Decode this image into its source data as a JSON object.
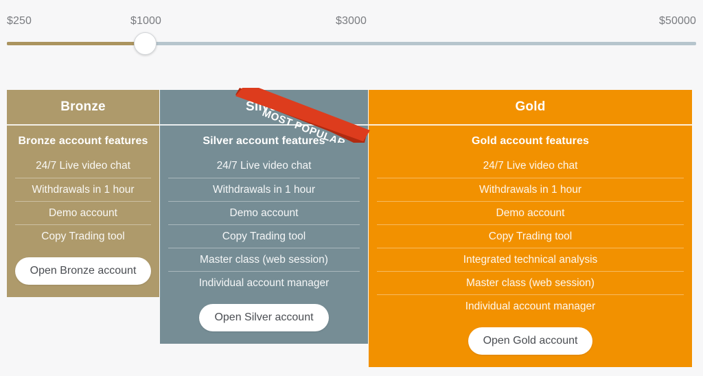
{
  "slider": {
    "ticks": [
      {
        "label": "$250"
      },
      {
        "label": "$1000"
      },
      {
        "label": "$3000"
      },
      {
        "label": "$50000"
      }
    ],
    "selected_value": "$1000",
    "fill_color": "#ab945f",
    "track_color": "#b6c5cd",
    "thumb_color": "#ffffff",
    "fill_percent": 20
  },
  "ribbon": {
    "label": "MOST POPULAR",
    "color": "#dd3c1d"
  },
  "plans": [
    {
      "id": "bronze",
      "name": "Bronze",
      "color": "#ae9a6b",
      "features_title": "Bronze account features",
      "features": [
        "24/7 Live video chat",
        "Withdrawals in 1 hour",
        "Demo account",
        "Copy Trading tool"
      ],
      "button_label": "Open Bronze account"
    },
    {
      "id": "silver",
      "name": "Silver",
      "color": "#768d95",
      "features_title": "Silver account features",
      "features": [
        "24/7 Live video chat",
        "Withdrawals in 1 hour",
        "Demo account",
        "Copy Trading tool",
        "Master class (web session)",
        "Individual account manager"
      ],
      "button_label": "Open Silver account",
      "most_popular": true
    },
    {
      "id": "gold",
      "name": "Gold",
      "color": "#f29100",
      "features_title": "Gold account features",
      "features": [
        "24/7 Live video chat",
        "Withdrawals in 1 hour",
        "Demo account",
        "Copy Trading tool",
        "Integrated technical analysis",
        "Master class (web session)",
        "Individual account manager"
      ],
      "button_label": "Open Gold account"
    }
  ]
}
